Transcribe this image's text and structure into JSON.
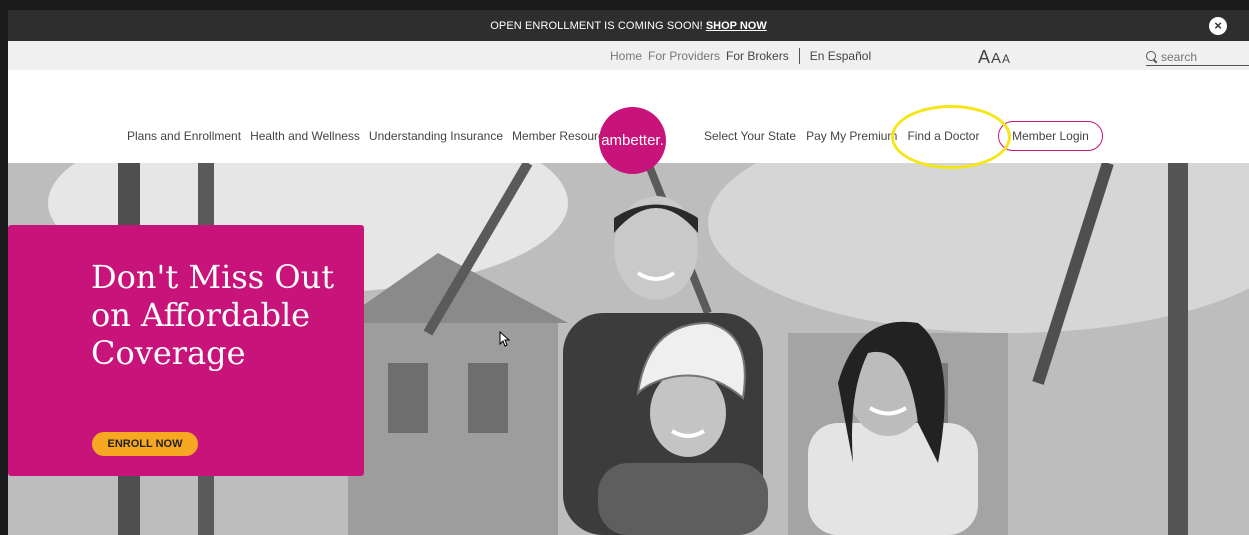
{
  "banner": {
    "text": "OPEN ENROLLMENT IS COMING SOON!",
    "link": "SHOP NOW",
    "close_icon": "close-icon"
  },
  "utility": {
    "links": [
      "Home",
      "For Providers",
      "For Brokers"
    ],
    "spanish": "En Español",
    "text_size": [
      "A",
      "A",
      "A"
    ],
    "search_placeholder": "search"
  },
  "nav": {
    "left_items": [
      "Plans and Enrollment",
      "Health and Wellness",
      "Understanding Insurance",
      "Member Resources"
    ],
    "logo": "ambetter.",
    "right_items": [
      "Select Your State",
      "Pay My Premium",
      "Find a Doctor"
    ],
    "login": "Member Login"
  },
  "hero": {
    "promo_title": "Don't Miss Out on Affordable Coverage",
    "cta": "ENROLL NOW"
  },
  "colors": {
    "brand": "#c8137a",
    "cta": "#f7a823",
    "highlight": "#f5e61a",
    "banner_bg": "#2e2e2e"
  }
}
